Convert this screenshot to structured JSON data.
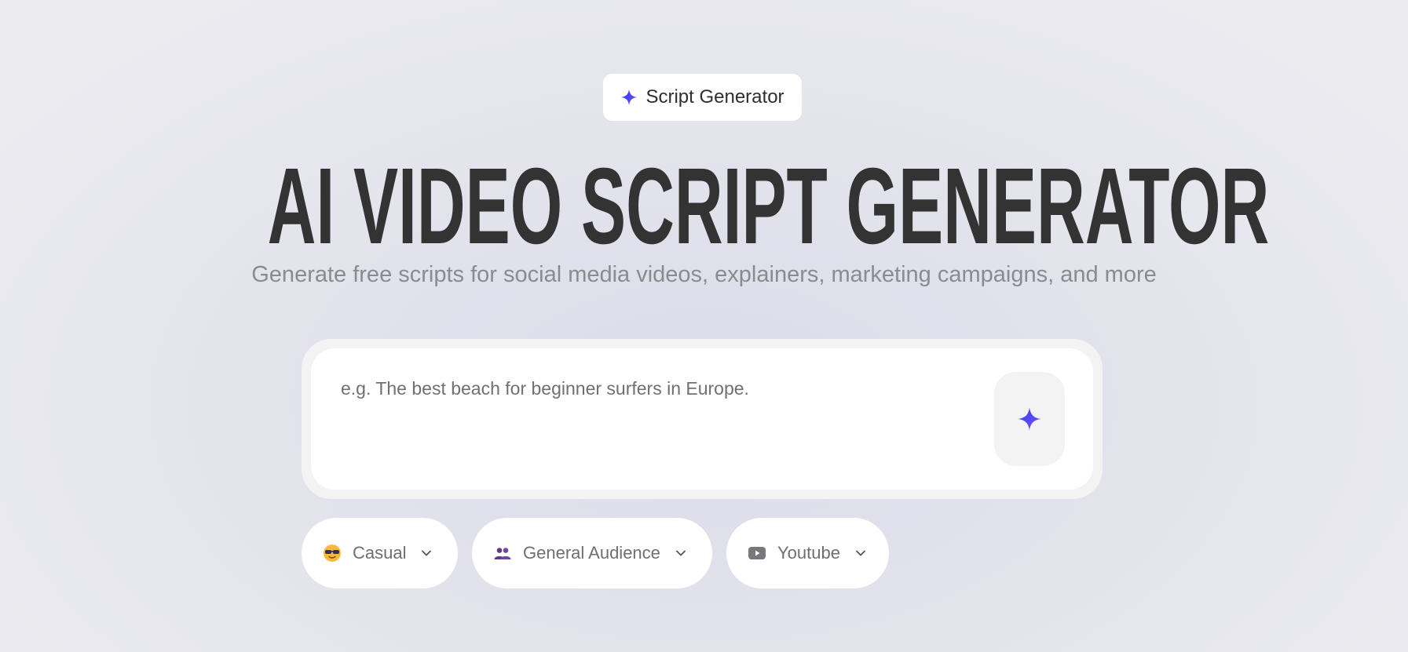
{
  "badge": {
    "label": "Script Generator",
    "icon": "sparkle-icon"
  },
  "hero": {
    "title": "AI VIDEO SCRIPT GENERATOR",
    "subtitle": "Generate free scripts for social media videos, explainers, marketing campaigns, and more"
  },
  "prompt": {
    "placeholder": "e.g. The best beach for beginner surfers in Europe.",
    "value": "",
    "submit_icon": "sparkle-icon"
  },
  "options": {
    "tone": {
      "label": "Casual",
      "icon": "sunglasses-face-icon"
    },
    "audience": {
      "label": "General Audience",
      "icon": "people-icon"
    },
    "platform": {
      "label": "Youtube",
      "icon": "youtube-icon"
    }
  },
  "colors": {
    "accent": "#4b3cf2",
    "title": "#333333",
    "subtitle": "#8a8a90"
  }
}
